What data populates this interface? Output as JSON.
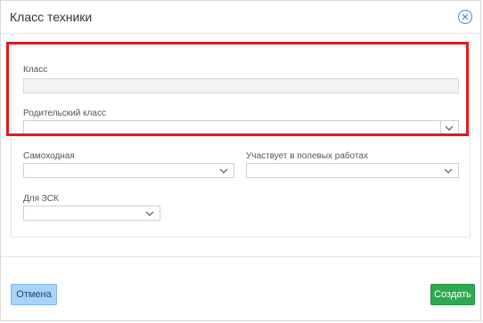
{
  "dialog": {
    "title": "Класс техники"
  },
  "form": {
    "class_label": "Класс",
    "class_value": "",
    "parent_class_label": "Родительский класс",
    "parent_class_value": "",
    "self_propelled_label": "Самоходная",
    "self_propelled_value": "",
    "field_work_label": "Участвует в полевых работах",
    "field_work_value": "",
    "zsk_label": "Для ЗСК",
    "zsk_value": ""
  },
  "footer": {
    "cancel_label": "Отмена",
    "create_label": "Создать"
  },
  "colors": {
    "highlight": "#e01a1a",
    "create_button": "#2fa84f",
    "cancel_button": "#a8d2f6",
    "close_icon": "#3a86c8"
  },
  "icons": {
    "close": "close-circle-icon",
    "dropdown": "chevron-down-icon"
  }
}
